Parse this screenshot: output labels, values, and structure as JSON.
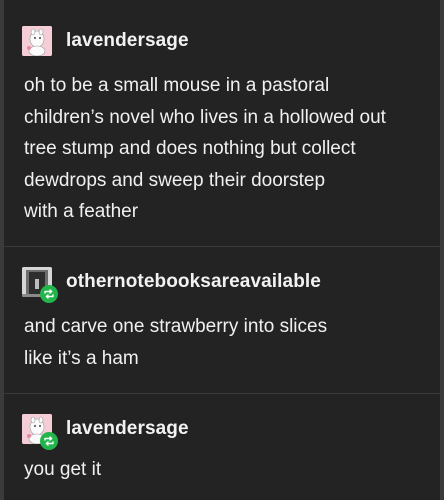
{
  "posts": [
    {
      "username": "lavendersage",
      "text_lines": [
        "oh to be a small mouse in a pastoral",
        "children’s novel who lives in a hollowed out",
        "tree stump and does nothing but collect",
        "dewdrops and sweep their doorstep",
        "with a feather"
      ],
      "avatar_icon": "moomin-avatar-icon",
      "reblog": false
    },
    {
      "username": "othernotebooksareavailable",
      "text_lines": [
        "and carve one strawberry into slices",
        "like it’s a ham"
      ],
      "avatar_icon": "doorway-avatar-icon",
      "reblog": true
    },
    {
      "username": "lavendersage",
      "text_lines": [
        "you get it"
      ],
      "avatar_icon": "moomin-avatar-icon",
      "reblog": true
    }
  ],
  "colors": {
    "background": "#232323",
    "text": "#f0f0f0",
    "divider": "#3a3a3a",
    "reblog_badge": "#21b54c"
  }
}
